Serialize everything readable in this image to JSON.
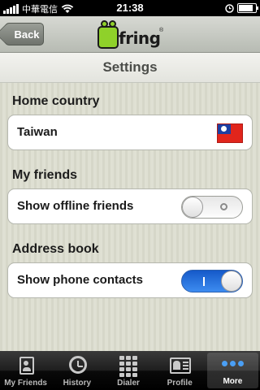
{
  "status_bar": {
    "carrier": "中華電信",
    "time": "21:38",
    "battery_level": 0.95
  },
  "nav": {
    "back_label": "Back",
    "logo_text": "fring"
  },
  "page": {
    "title": "Settings"
  },
  "sections": {
    "home_country": {
      "title": "Home country",
      "value": "Taiwan",
      "flag": "taiwan-flag"
    },
    "my_friends": {
      "title": "My friends",
      "row_label": "Show offline friends",
      "toggle_on": false
    },
    "address_book": {
      "title": "Address book",
      "row_label": "Show phone contacts",
      "toggle_on": true
    }
  },
  "tabs": [
    {
      "label": "My Friends",
      "icon": "contacts-icon"
    },
    {
      "label": "History",
      "icon": "clock-icon"
    },
    {
      "label": "Dialer",
      "icon": "keypad-icon"
    },
    {
      "label": "Profile",
      "icon": "profile-card-icon"
    },
    {
      "label": "More",
      "icon": "more-dots-icon",
      "active": true
    }
  ],
  "colors": {
    "toggle_on": "#1559c9",
    "more_dots": "#4a9ff5",
    "logo_green": "#8fd12a"
  }
}
